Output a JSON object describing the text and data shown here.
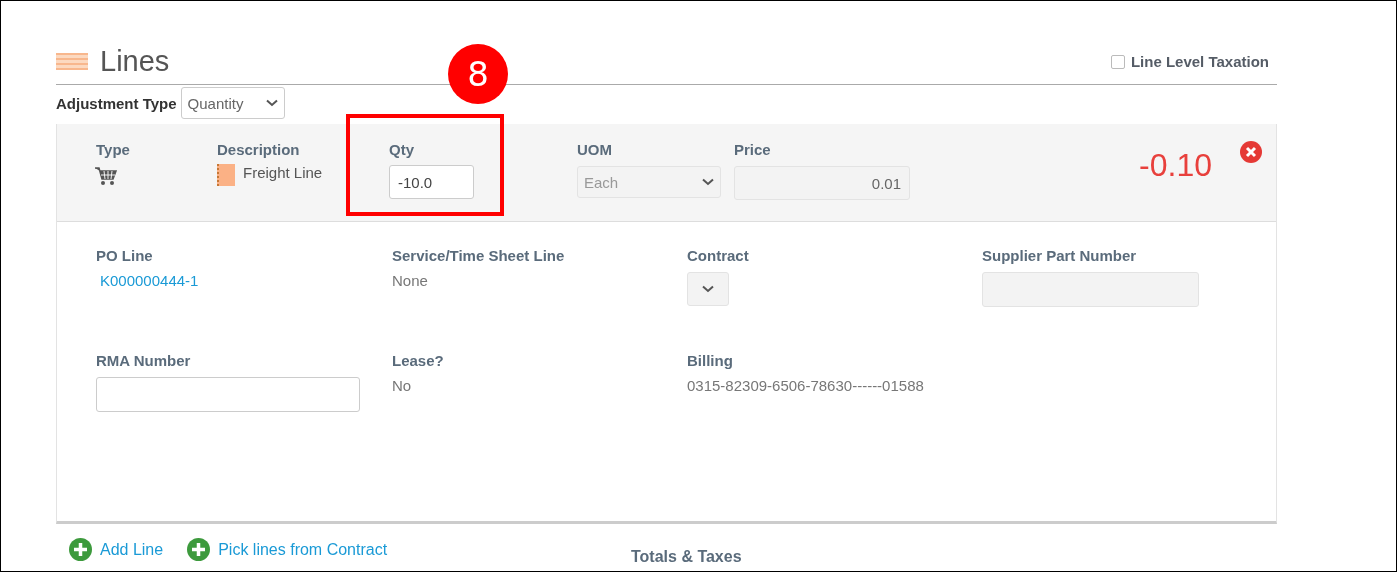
{
  "section": {
    "title": "Lines",
    "line_level_taxation": {
      "label": "Line Level Taxation",
      "checked": false
    }
  },
  "adjustment_type": {
    "label": "Adjustment Type",
    "value": "Quantity"
  },
  "annotation": {
    "number": "8"
  },
  "line": {
    "type_label": "Type",
    "description_label": "Description",
    "description": "Freight Line",
    "qty_label": "Qty",
    "qty": "-10.0",
    "uom_label": "UOM",
    "uom": "Each",
    "uom_disabled": true,
    "price_label": "Price",
    "price": "0.01",
    "total": "-0.10",
    "fields": [
      {
        "kind": "link",
        "label": "PO Line",
        "value": "K000000444-1"
      },
      {
        "kind": "text",
        "label": "Service/Time Sheet Line",
        "value": "None"
      },
      {
        "kind": "select",
        "label": "Contract"
      },
      {
        "kind": "input",
        "label": "Supplier Part Number",
        "disabled": true
      },
      {
        "kind": "input",
        "label": "RMA Number",
        "disabled": false
      },
      {
        "kind": "text",
        "label": "Lease?",
        "value": "No"
      },
      {
        "kind": "text",
        "label": "Billing",
        "value": "0315-82309-6506-78630------01588"
      }
    ]
  },
  "actions": [
    {
      "label": "Add Line"
    },
    {
      "label": "Pick lines from Contract"
    }
  ],
  "totals": {
    "title": "Totals & Taxes"
  }
}
